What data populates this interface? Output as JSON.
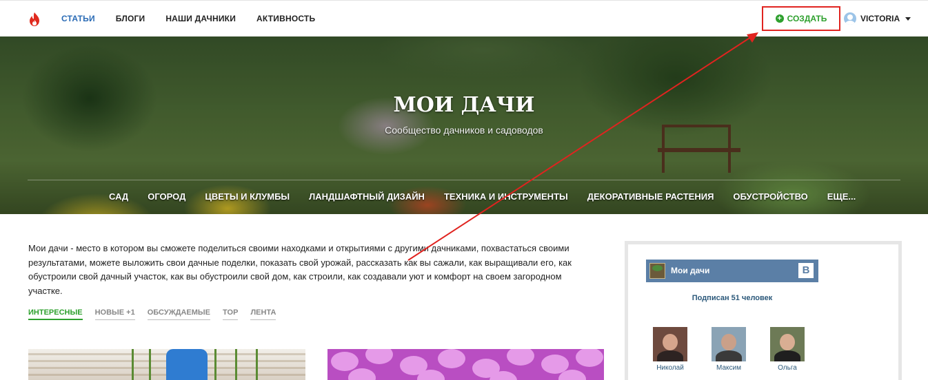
{
  "nav": {
    "logo_icon": "flame-icon",
    "items": [
      {
        "label": "СТАТЬИ",
        "active": true
      },
      {
        "label": "БЛОГИ",
        "active": false
      },
      {
        "label": "НАШИ ДАЧНИКИ",
        "active": false
      },
      {
        "label": "АКТИВНОСТЬ",
        "active": false
      }
    ],
    "create_label": "СОЗДАТЬ",
    "create_icon": "plus-circle-icon",
    "user_name": "VICTORIA",
    "user_icon": "user-avatar-icon"
  },
  "hero": {
    "title": "МОИ ДАЧИ",
    "subtitle": "Сообщество дачников и садоводов",
    "categories": [
      "САД",
      "ОГОРОД",
      "ЦВЕТЫ И КЛУМБЫ",
      "ЛАНДШАФТНЫЙ ДИЗАЙН",
      "ТЕХНИКА И ИНСТРУМЕНТЫ",
      "ДЕКОРАТИВНЫЕ РАСТЕНИЯ",
      "ОБУСТРОЙСТВО",
      "ЕЩЕ..."
    ]
  },
  "main": {
    "description": "Мои дачи - место в котором вы сможете поделиться своими находками и открытиями с другими дачниками, похвастаться своими результатами, можете выложить свои дачные поделки, показать свой урожай, рассказать как вы сажали, как выращивали его, как обустроили свой дачный участок, как вы обустроили свой дом, как строили, как создавали уют и комфорт на своем загородном участке.",
    "tabs": [
      {
        "label": "ИНТЕРЕСНЫЕ",
        "active": true
      },
      {
        "label": "НОВЫЕ +1",
        "active": false
      },
      {
        "label": "ОБСУЖДАЕМЫЕ",
        "active": false
      },
      {
        "label": "TOP",
        "active": false
      },
      {
        "label": "ЛЕНТА",
        "active": false
      }
    ]
  },
  "sidebar": {
    "group_name": "Мои дачи",
    "vk_letter": "B",
    "subscribers": "Подписан 51 человек",
    "members": [
      {
        "name": "Николай"
      },
      {
        "name": "Максим"
      },
      {
        "name": "Ольга"
      }
    ]
  },
  "colors": {
    "accent_blue": "#2a6bb5",
    "accent_green": "#2ea02e",
    "highlight_red": "#e0231f",
    "vk_blue": "#5b7fa6"
  }
}
